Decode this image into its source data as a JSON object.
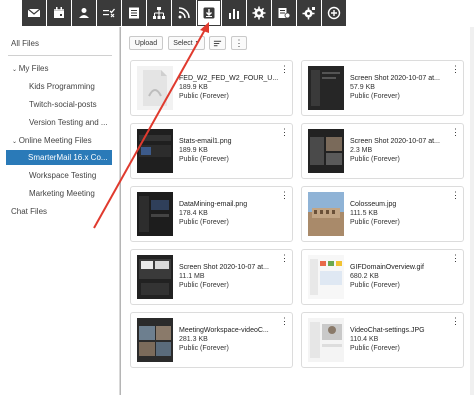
{
  "colors": {
    "toolbar_bg": "#3a3a3a",
    "selected_bg": "#2a7ab8",
    "arrow": "#e03a2e"
  },
  "toolbar": {
    "icons": [
      "mail-icon",
      "calendar-icon",
      "contacts-icon",
      "tasks-icon",
      "notes-icon",
      "network-icon",
      "rss-icon",
      "file-storage-icon",
      "reports-icon",
      "settings-icon",
      "sysadmin-settings-icon",
      "gear-alt-icon",
      "add-icon"
    ],
    "active_index": 7
  },
  "sidebar": {
    "all_files": "All Files",
    "my_files": "My Files",
    "items": [
      "Kids Programming",
      "Twitch-social-posts",
      "Version Testing and ..."
    ],
    "online_meeting_files": "Online Meeting Files",
    "meeting_items": [
      "SmarterMail 16.x Co...",
      "Workspace Testing",
      "Marketing Meeting"
    ],
    "chat_files": "Chat Files",
    "selected": "SmarterMail 16.x Co..."
  },
  "main": {
    "upload_label": "Upload",
    "select_label": "Select",
    "files": [
      {
        "name": "FED_W2_FED_W2_FOUR_U...",
        "size": "189.9 KB",
        "visibility": "Public (Forever)",
        "thumb": "pdf"
      },
      {
        "name": "Screen Shot 2020-10-07 at...",
        "size": "57.9 KB",
        "visibility": "Public (Forever)",
        "thumb": "dark"
      },
      {
        "name": "Stats-email1.png",
        "size": "189.9 KB",
        "visibility": "Public (Forever)",
        "thumb": "dark"
      },
      {
        "name": "Screen Shot 2020-10-07 at...",
        "size": "2.3 MB",
        "visibility": "Public (Forever)",
        "thumb": "dark"
      },
      {
        "name": "DataMining-email.png",
        "size": "178.4 KB",
        "visibility": "Public (Forever)",
        "thumb": "dark"
      },
      {
        "name": "Colosseum.jpg",
        "size": "111.5 KB",
        "visibility": "Public (Forever)",
        "thumb": "photo"
      },
      {
        "name": "Screen Shot 2020-10-07 at...",
        "size": "11.1 MB",
        "visibility": "Public (Forever)",
        "thumb": "dark"
      },
      {
        "name": "GIFDomainOverview.gif",
        "size": "680.2 KB",
        "visibility": "Public (Forever)",
        "thumb": "light"
      },
      {
        "name": "MeetingWorkspace-videoC...",
        "size": "281.3 KB",
        "visibility": "Public (Forever)",
        "thumb": "photo"
      },
      {
        "name": "VideoChat-settings.JPG",
        "size": "110.4 KB",
        "visibility": "Public (Forever)",
        "thumb": "light"
      }
    ]
  }
}
